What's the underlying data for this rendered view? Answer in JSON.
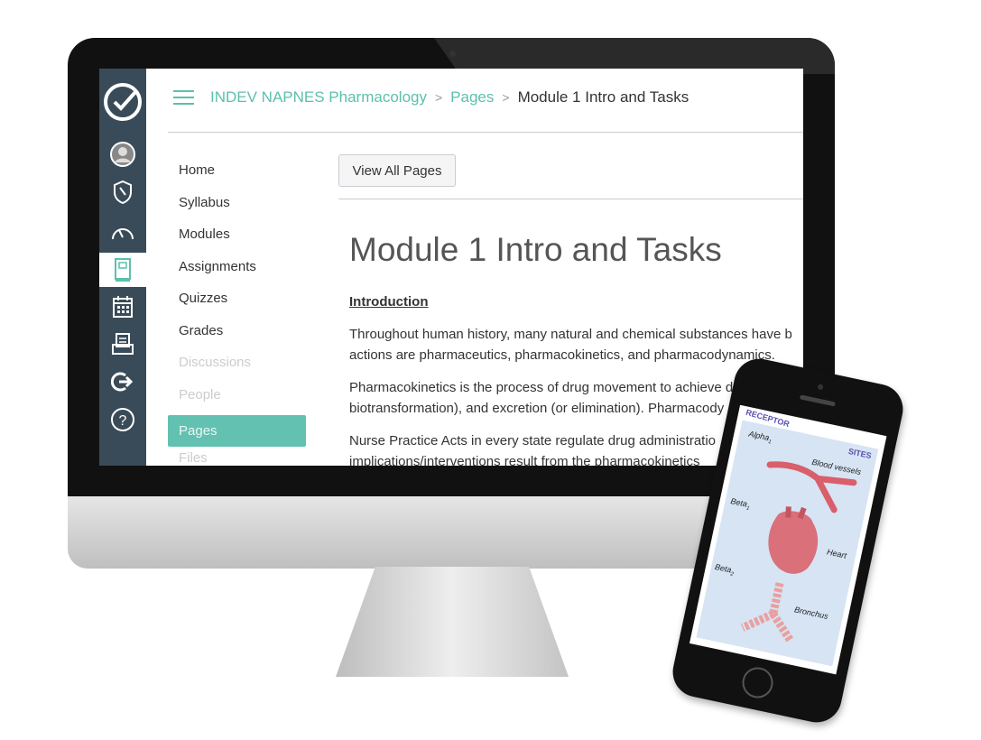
{
  "breadcrumb": {
    "course": "INDEV NAPNES Pharmacology",
    "section": "Pages",
    "current": "Module 1 Intro and Tasks"
  },
  "global_nav": [
    {
      "icon": "logo-check-icon"
    },
    {
      "icon": "account-icon"
    },
    {
      "icon": "admin-shield-icon"
    },
    {
      "icon": "dashboard-icon"
    },
    {
      "icon": "courses-book-icon",
      "active": true
    },
    {
      "icon": "calendar-icon"
    },
    {
      "icon": "inbox-icon"
    },
    {
      "icon": "logout-icon"
    },
    {
      "icon": "help-icon"
    }
  ],
  "course_nav": [
    {
      "label": "Home",
      "state": "enabled"
    },
    {
      "label": "Syllabus",
      "state": "enabled"
    },
    {
      "label": "Modules",
      "state": "enabled"
    },
    {
      "label": "Assignments",
      "state": "enabled"
    },
    {
      "label": "Quizzes",
      "state": "enabled"
    },
    {
      "label": "Grades",
      "state": "enabled"
    },
    {
      "label": "Discussions",
      "state": "disabled"
    },
    {
      "label": "People",
      "state": "disabled"
    },
    {
      "label": "Pages",
      "state": "active"
    },
    {
      "label": "Files",
      "state": "disabled"
    }
  ],
  "view_all_pages": "View All Pages",
  "page": {
    "title": "Module 1 Intro and Tasks",
    "heading": "Introduction",
    "paragraphs": [
      [
        "Throughout human history, many natural and chemical substances have b",
        "actions are pharmaceutics, pharmacokinetics, and pharmacodynamics."
      ],
      [
        "Pharmacokinetics is the process of drug movement to achieve d",
        "biotransformation), and excretion (or elimination).  Pharmacody"
      ],
      [
        "Nurse Practice Acts in every state regulate drug administratio",
        "implications/interventions result from the pharmacokinetics"
      ]
    ]
  },
  "phone": {
    "header_left": "RECEPTOR",
    "header_right": "SITES",
    "labels": {
      "alpha": "Alpha",
      "alpha_sub": "1",
      "vessels": "Blood vessels",
      "beta1": "Beta",
      "beta1_sub": "1",
      "heart": "Heart",
      "beta2": "Beta",
      "beta2_sub": "2",
      "bronchus": "Bronchus"
    }
  },
  "colors": {
    "accent": "#5cc0ac",
    "sidebar": "#394b58",
    "active_nav": "#62c1b0"
  }
}
